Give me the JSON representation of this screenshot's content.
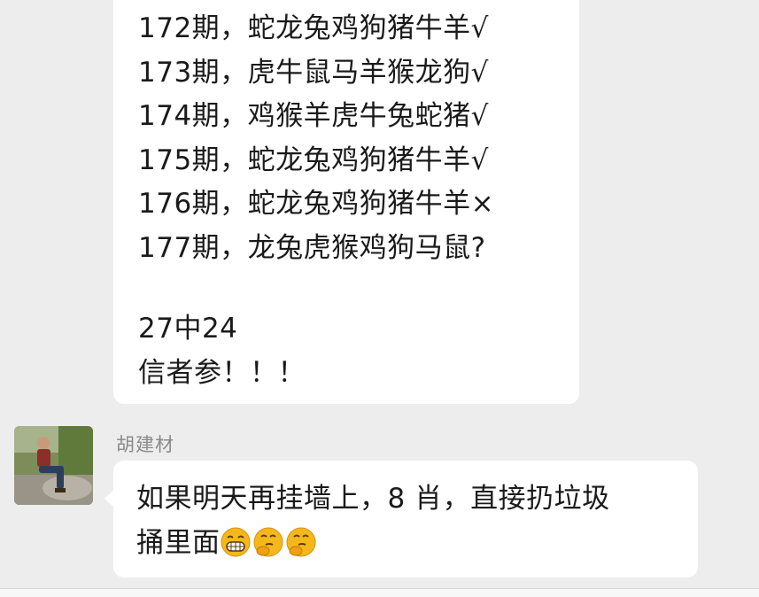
{
  "messages": [
    {
      "lines": [
        "172期，蛇龙兔鸡狗猪牛羊√",
        "173期，虎牛鼠马羊猴龙狗√",
        "174期，鸡猴羊虎牛兔蛇猪√",
        "175期，蛇龙兔鸡狗猪牛羊√",
        "176期，蛇龙兔鸡狗猪牛羊×",
        "177期，龙兔虎猴鸡狗马鼠?",
        "27中24",
        "信者参！！！"
      ]
    },
    {
      "sender": "胡建材",
      "lines": [
        "如果明天再挂墙上，8 肖，直接扔垃圾",
        "捅里面"
      ],
      "emojis": [
        "grin-emoji",
        "thinking-emoji",
        "thinking-emoji"
      ]
    }
  ],
  "colors": {
    "background": "#ededed",
    "bubble": "#ffffff",
    "sender_name": "#8a8a8a",
    "emoji": "#f5b81c"
  }
}
